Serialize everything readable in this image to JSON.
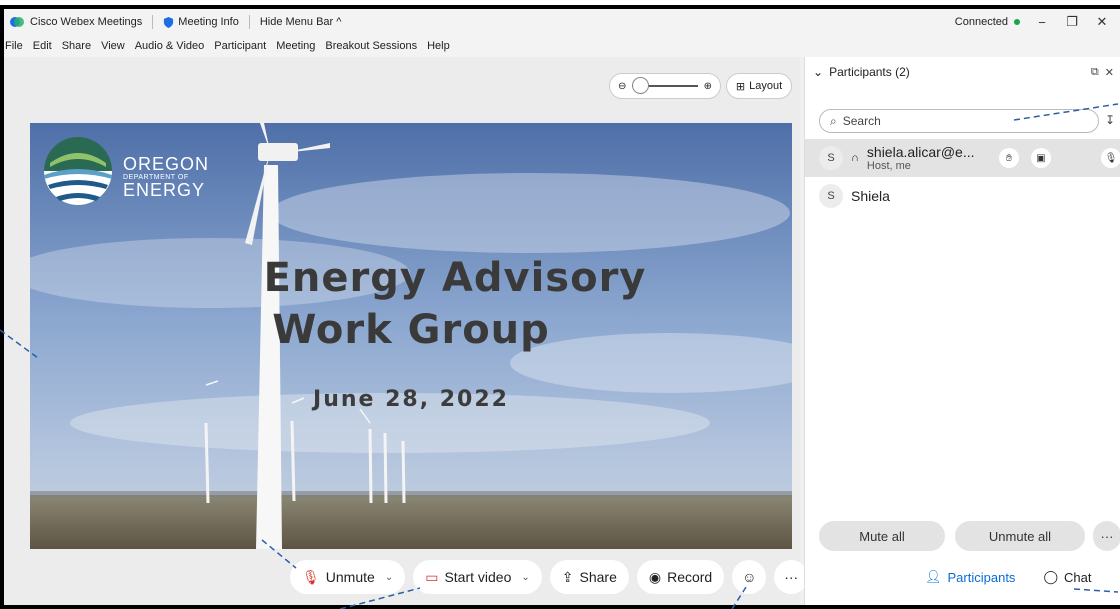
{
  "titlebar": {
    "app_name": "Cisco Webex Meetings",
    "meeting_info": "Meeting Info",
    "hide_menu_bar": "Hide Menu Bar ^",
    "status": "Connected"
  },
  "menubar": {
    "items": [
      "File",
      "Edit",
      "Share",
      "View",
      "Audio & Video",
      "Participant",
      "Meeting",
      "Breakout Sessions",
      "Help"
    ]
  },
  "stage": {
    "layout_label": "Layout",
    "slide": {
      "logo_line1": "OREGON",
      "logo_line2": "DEPARTMENT OF",
      "logo_line3": "ENERGY",
      "title_line1": "Energy Advisory",
      "title_line2": "Work Group",
      "date": "June 28, 2022"
    }
  },
  "controls": {
    "unmute": "Unmute",
    "start_video": "Start video",
    "share": "Share",
    "record": "Record",
    "more": "···"
  },
  "participants": {
    "header": "Participants (2)",
    "search_placeholder": "Search",
    "list": [
      {
        "initial": "S",
        "name": "shiela.alicar@e...",
        "role": "Host, me"
      },
      {
        "initial": "S",
        "name": "Shiela",
        "role": ""
      }
    ],
    "mute_all": "Mute all",
    "unmute_all": "Unmute all",
    "more": "···"
  },
  "bottom_tabs": {
    "participants": "Participants",
    "chat": "Chat",
    "more": "···"
  },
  "colors": {
    "end_call": "#e9322d",
    "accent_blue": "#0b6cd6",
    "connected_green": "#1aa34a",
    "mute_red": "#d6312c"
  }
}
